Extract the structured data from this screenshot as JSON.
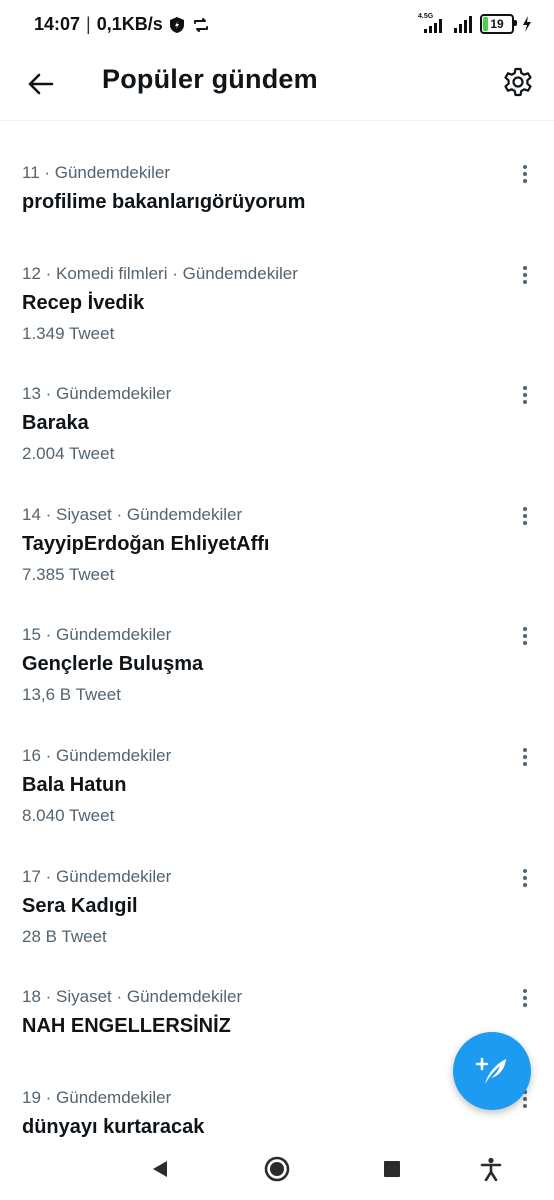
{
  "status_bar": {
    "time": "14:07",
    "speed": "0,1KB/s",
    "network_type": "4.5G",
    "battery": "19"
  },
  "header": {
    "title": "Popüler gündem",
    "back_icon": "arrow-left-icon",
    "settings_icon": "gear-icon"
  },
  "trends": [
    {
      "meta": "11 · Gündemdekiler",
      "name": "profilime bakanlarıgörüyorum",
      "count": ""
    },
    {
      "meta": "12 · Komedi filmleri · Gündemdekiler",
      "name": "Recep İvedik",
      "count": "1.349 Tweet"
    },
    {
      "meta": "13 · Gündemdekiler",
      "name": "Baraka",
      "count": "2.004 Tweet"
    },
    {
      "meta": "14 · Siyaset · Gündemdekiler",
      "name": "TayyipErdoğan EhliyetAffı",
      "count": "7.385 Tweet"
    },
    {
      "meta": "15 · Gündemdekiler",
      "name": "Gençlerle Buluşma",
      "count": "13,6 B Tweet"
    },
    {
      "meta": "16 · Gündemdekiler",
      "name": "Bala Hatun",
      "count": "8.040 Tweet"
    },
    {
      "meta": "17 · Gündemdekiler",
      "name": "Sera Kadıgil",
      "count": "28 B Tweet"
    },
    {
      "meta": "18 · Siyaset · Gündemdekiler",
      "name": "NAH ENGELLERSİNİZ",
      "count": ""
    },
    {
      "meta": "19 · Gündemdekiler",
      "name": "dünyayı kurtaracak",
      "count": ""
    }
  ],
  "fab": {
    "icon": "compose-tweet-icon",
    "color": "#1d9bf0"
  },
  "colors": {
    "accent": "#1d9bf0",
    "text_primary": "#0f1419",
    "text_secondary": "#536471"
  }
}
